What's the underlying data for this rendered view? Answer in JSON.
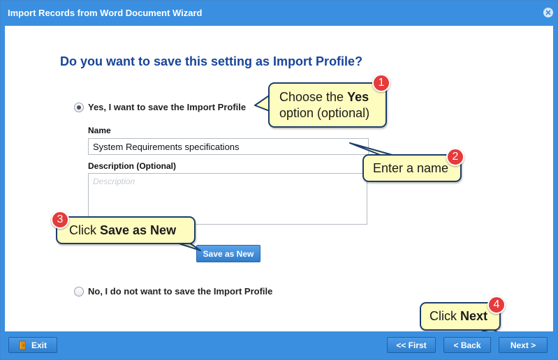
{
  "window": {
    "title": "Import Records from Word Document Wizard"
  },
  "content": {
    "question": "Do you want to save this setting as Import Profile?",
    "option_yes": "Yes, I want to save the Import Profile",
    "name_label": "Name",
    "name_value": "System Requirements specifications",
    "description_label": "Description (Optional)",
    "description_placeholder": "Description",
    "save_as_new_label": "Save as New",
    "option_no": "No, I do not want to save the Import Profile"
  },
  "callouts": {
    "c1": {
      "badge": "1",
      "line1_pre": "Choose the ",
      "line1_bold": "Yes",
      "line2": "option (optional)"
    },
    "c2": {
      "badge": "2",
      "text": "Enter a name"
    },
    "c3": {
      "badge": "3",
      "pre": "Click ",
      "bold": "Save as New"
    },
    "c4": {
      "badge": "4",
      "pre": "Click ",
      "bold": "Next"
    }
  },
  "footer": {
    "exit_label": "Exit",
    "first_label": "<< First",
    "back_label": "< Back",
    "next_label": "Next >"
  },
  "colors": {
    "titlebar": "#3b8fe0",
    "heading": "#17459a",
    "callout_fill": "#fffcc0",
    "badge": "#e53b3b"
  }
}
